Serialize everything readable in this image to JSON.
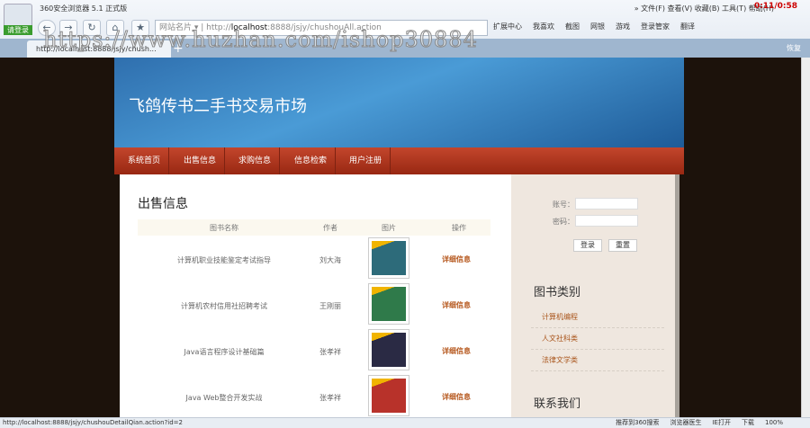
{
  "browser": {
    "title": "360安全浏览器 5.1 正式版",
    "login": "请登录",
    "address_host": "localhost",
    "address_prefix": "http://",
    "address_rest": ":8888/jsjy/chushouAll.action",
    "site_name_btn": "网站名片",
    "menu": "» 文件(F)  查看(V)  收藏(B)  工具(T)  帮助(H)",
    "timer": "0:11/0:58",
    "tools": [
      "扩展中心",
      "我喜欢",
      "截图",
      "网银",
      "游戏",
      "登录管家",
      "翻译"
    ],
    "tab_title": "http://localhost:8888/jsjy/chush...",
    "tab_right": "恢复",
    "watermark": "https://www.huzhan.com/ishop30884"
  },
  "site": {
    "title": "飞鸽传书二手书交易市场",
    "nav": [
      "系统首页",
      "出售信息",
      "求购信息",
      "信息检索",
      "用户注册"
    ]
  },
  "main": {
    "heading": "出售信息",
    "columns": [
      "图书名称",
      "作者",
      "图片",
      "操作"
    ],
    "rows": [
      {
        "name": "计算机职业技能鉴定考试指导",
        "author": "刘大海",
        "action": "详细信息",
        "color": "#2d6b7a"
      },
      {
        "name": "计算机农村信用社招聘考试",
        "author": "王刚丽",
        "action": "详细信息",
        "color": "#2f7a4a"
      },
      {
        "name": "Java语言程序设计基础篇",
        "author": "张孝祥",
        "action": "详细信息",
        "color": "#2a2a44"
      },
      {
        "name": "Java Web整合开发实战",
        "author": "张孝祥",
        "action": "详细信息",
        "color": "#b8322a"
      }
    ]
  },
  "sidebar": {
    "account_label": "账号：",
    "password_label": "密码：",
    "login": "登录",
    "reset": "重置",
    "category_heading": "图书类别",
    "categories": [
      "计算机编程",
      "人文社科类",
      "法律文学类"
    ],
    "contact_heading": "联系我们"
  },
  "status": {
    "url": "http://localhost:8888/jsjy/chushouDetailQian.action?id=2",
    "items": [
      "推荐到360搜索",
      "浏览器医生",
      "IE打开",
      "下载",
      "100%"
    ]
  }
}
